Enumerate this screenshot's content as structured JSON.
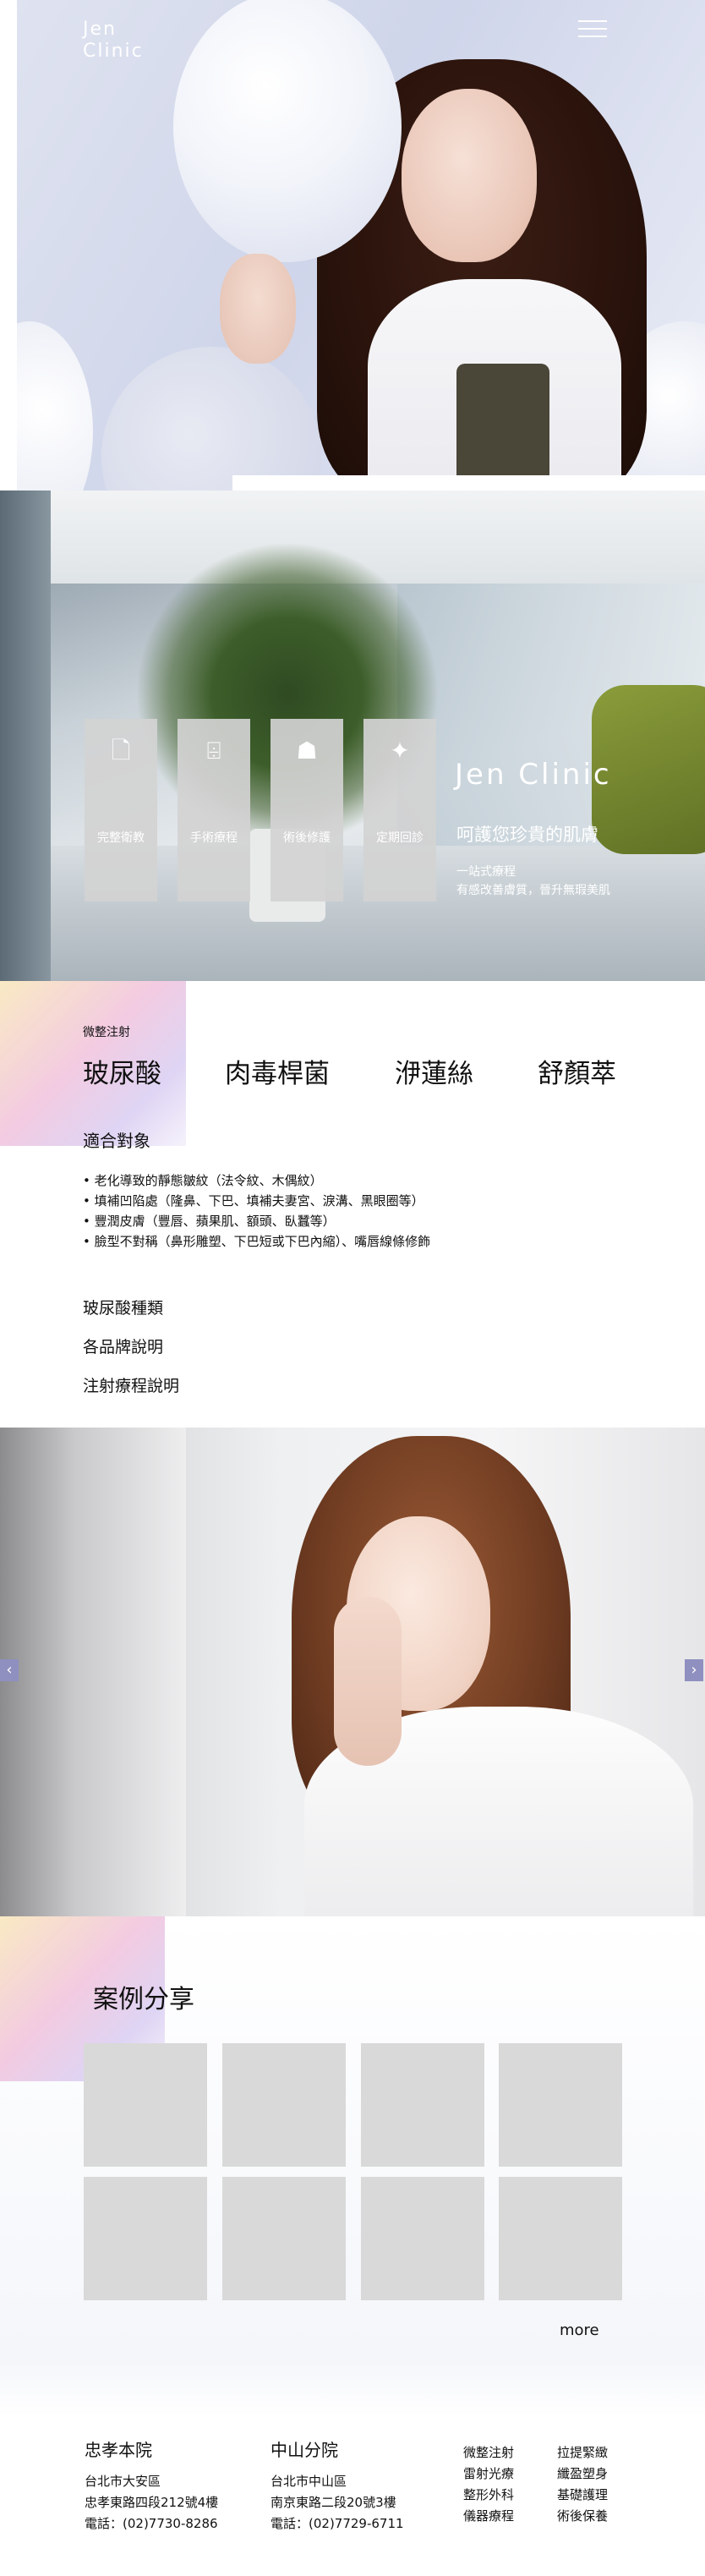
{
  "header": {
    "logo_line1": "Jen",
    "logo_line2": "Clinic"
  },
  "clinic": {
    "services": [
      {
        "label": "完整衛教",
        "icon": "document-icon"
      },
      {
        "label": "手術療程",
        "icon": "syringe-icon"
      },
      {
        "label": "術後修護",
        "icon": "iv-bag-icon"
      },
      {
        "label": "定期回診",
        "icon": "sparkle-icon"
      }
    ],
    "title": "Jen Clinic",
    "subtitle": "呵護您珍貴的肌膚",
    "desc_line1": "一站式療程",
    "desc_line2": "有感改善膚質，晉升無瑕美肌"
  },
  "injection": {
    "category": "微整注射",
    "tabs": [
      "玻尿酸",
      "肉毒桿菌",
      "洢蓮絲",
      "舒顏萃"
    ],
    "fit_title": "適合對象",
    "fit_items": [
      "老化導致的靜態皺紋（法令紋、木偶紋）",
      "填補凹陷處（隆鼻、下巴、填補夫妻宮、淚溝、黑眼圈等）",
      "豐潤皮膚（豐唇、蘋果肌、額頭、臥蠶等）",
      "臉型不對稱（鼻形雕塑、下巴短或下巴內縮）、嘴唇線條修飾"
    ],
    "links": [
      "玻尿酸種類",
      "各品牌說明",
      "注射療程說明"
    ]
  },
  "carousel": {
    "prev": "‹",
    "next": "›"
  },
  "cases": {
    "title": "案例分享",
    "more": "more"
  },
  "footer": {
    "branches": [
      {
        "name": "忠孝本院",
        "district": "台北市大安區",
        "address": "忠孝東路四段212號4樓",
        "phone": "電話：(02)7730-8286"
      },
      {
        "name": "中山分院",
        "district": "台北市中山區",
        "address": "南京東路二段20號3樓",
        "phone": "電話：(02)7729-6711"
      }
    ],
    "links_col1": [
      "微整注射",
      "雷射光療",
      "整形外科",
      "儀器療程"
    ],
    "links_col2": [
      "拉提緊緻",
      "纖盈塑身",
      "基礎護理",
      "術後保養"
    ]
  }
}
